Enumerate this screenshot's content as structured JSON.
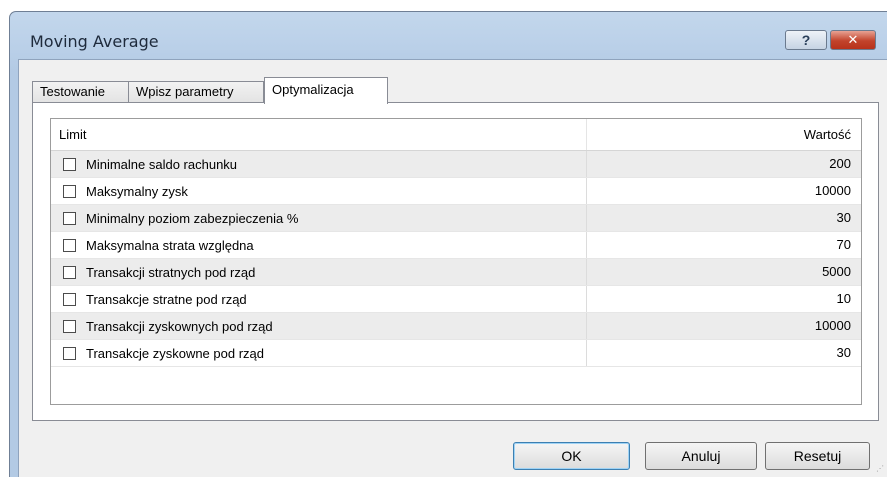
{
  "window": {
    "title": "Moving Average",
    "help_label": "?",
    "close_label": "✕"
  },
  "tabs": [
    {
      "label": "Testowanie",
      "active": false
    },
    {
      "label": "Wpisz parametry",
      "active": false
    },
    {
      "label": "Optymalizacja",
      "active": true
    }
  ],
  "table": {
    "columns": [
      "Limit",
      "Wartość"
    ],
    "rows": [
      {
        "checked": false,
        "limit": "Minimalne saldo rachunku",
        "value": "200"
      },
      {
        "checked": false,
        "limit": "Maksymalny zysk",
        "value": "10000"
      },
      {
        "checked": false,
        "limit": "Minimalny poziom zabezpieczenia %",
        "value": "30"
      },
      {
        "checked": false,
        "limit": "Maksymalna strata względna",
        "value": "70"
      },
      {
        "checked": false,
        "limit": "Transakcji stratnych pod rząd",
        "value": "5000"
      },
      {
        "checked": false,
        "limit": "Transakcje stratne pod rząd",
        "value": "10"
      },
      {
        "checked": false,
        "limit": "Transakcji zyskownych pod rząd",
        "value": "10000"
      },
      {
        "checked": false,
        "limit": "Transakcje zyskowne pod rząd",
        "value": "30"
      }
    ]
  },
  "buttons": {
    "ok": "OK",
    "cancel": "Anuluj",
    "reset": "Resetuj"
  },
  "colors": {
    "title_bar": "#b9cfe8",
    "close_button": "#c2432b",
    "row_alt": "#ececec"
  }
}
